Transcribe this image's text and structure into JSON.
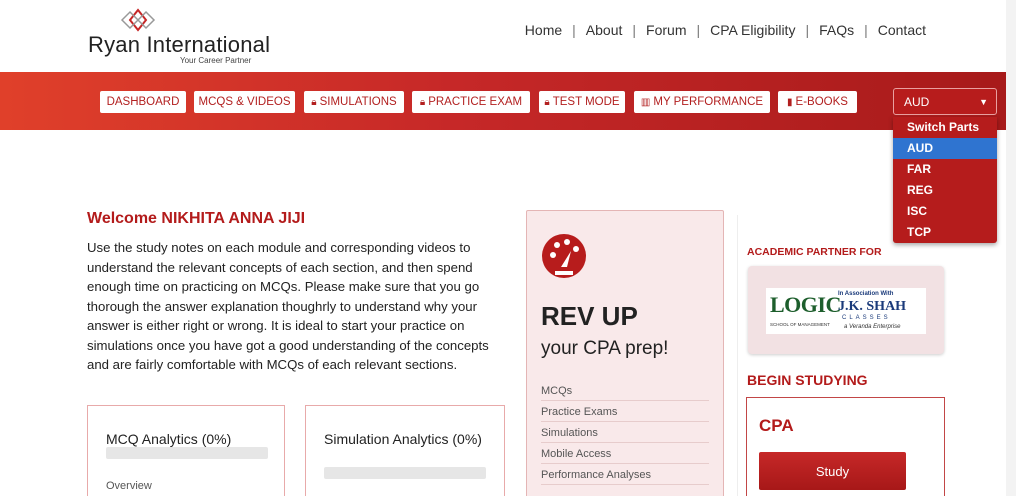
{
  "brand": {
    "name": "Ryan International",
    "tagline": "Your Career Partner",
    "accent": "#b31b1b"
  },
  "topnav": [
    "Home",
    "About",
    "Forum",
    "CPA Eligibility",
    "FAQs",
    "Contact"
  ],
  "mainnav": {
    "dashboard": "DASHBOARD",
    "mcqs": "MCQS & VIDEOS",
    "simulations": "SIMULATIONS",
    "practice": "PRACTICE EXAM",
    "testmode": "TEST MODE",
    "performance": "MY PERFORMANCE",
    "ebooks": "E-BOOKS"
  },
  "part_select": {
    "value": "AUD",
    "options": [
      "Switch Parts",
      "AUD",
      "FAR",
      "REG",
      "ISC",
      "TCP"
    ]
  },
  "welcome": "Welcome NIKHITA ANNA JIJI",
  "intro": "Use the study notes on each module and corresponding videos to understand the relevant concepts of each section, and then spend enough time on practicing on MCQs. Please make sure that you go thorough the answer explanation thoughrly to understand why your answer is either right or wrong. It is ideal to start your practice on simulations once you have got a good understanding of the concepts and are fairly comfortable with MCQs of each relevant sections.",
  "mcq_card": {
    "title": "MCQ Analytics (0%)",
    "sub": "Overview",
    "progress": 0
  },
  "sim_card": {
    "title": "Simulation Analytics (0%)",
    "progress": 0
  },
  "revup": {
    "heading": "REV UP",
    "sub": "your CPA prep!",
    "features": [
      "MCQs",
      "Practice Exams",
      "Simulations",
      "Mobile Access",
      "Performance Analyses"
    ]
  },
  "partner": {
    "heading": "ACADEMIC PARTNER FOR",
    "logo_left": "LOGIC",
    "logo_left_sub": "SCHOOL OF MANAGEMENT",
    "logo_assoc": "In Association With",
    "logo_right": "J.K. SHAH",
    "logo_right_sub": "CLASSES",
    "logo_right_tag": "a Veranda Enterprise"
  },
  "begin": {
    "heading": "BEGIN STUDYING",
    "course": "CPA",
    "button": "Study"
  }
}
